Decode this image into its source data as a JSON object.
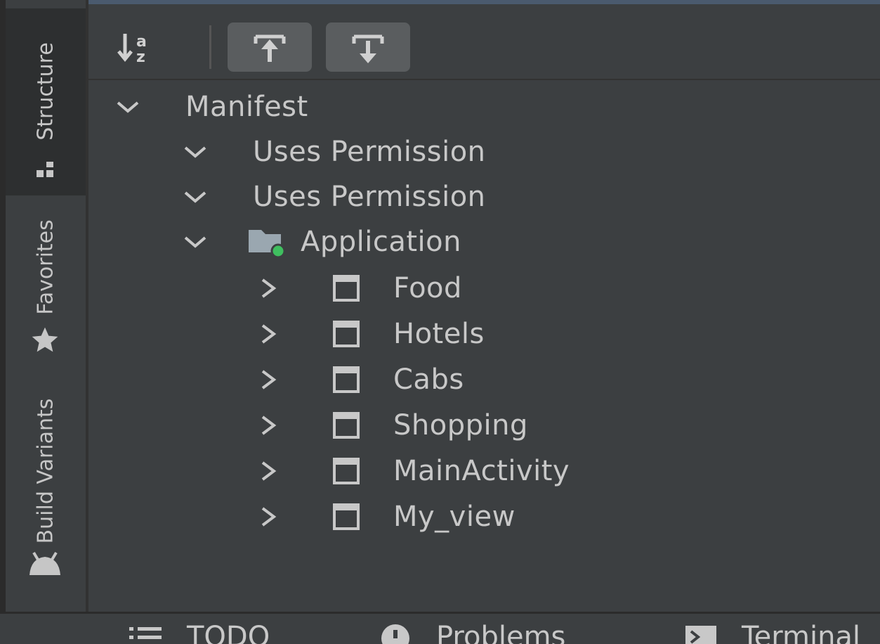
{
  "sidebar": {
    "tabs": [
      {
        "label": "Structure",
        "icon": "structure-icon",
        "active": true
      },
      {
        "label": "Favorites",
        "icon": "star-icon",
        "active": false
      },
      {
        "label": "Build Variants",
        "icon": "android-icon",
        "active": false
      }
    ]
  },
  "toolbar": {
    "buttons": [
      {
        "name": "sort-alphabetically",
        "icon": "sort-az-icon"
      },
      {
        "name": "expand-all",
        "icon": "expand-up-icon"
      },
      {
        "name": "collapse-all",
        "icon": "collapse-down-icon"
      }
    ]
  },
  "tree": {
    "root": {
      "label": "Manifest"
    },
    "perm1": {
      "label": "Uses Permission"
    },
    "perm2": {
      "label": "Uses Permission"
    },
    "app": {
      "label": "Application"
    },
    "children": [
      {
        "label": "Food"
      },
      {
        "label": "Hotels"
      },
      {
        "label": "Cabs"
      },
      {
        "label": "Shopping"
      },
      {
        "label": "MainActivity"
      },
      {
        "label": "My_view"
      }
    ]
  },
  "bottom": {
    "todo": "TODO",
    "problems": "Problems",
    "terminal": "Terminal"
  },
  "colors": {
    "background": "#3c3f41",
    "active_tab": "#2d2f30",
    "status_green": "#3fbf5f",
    "text": "#c8c8c8"
  }
}
